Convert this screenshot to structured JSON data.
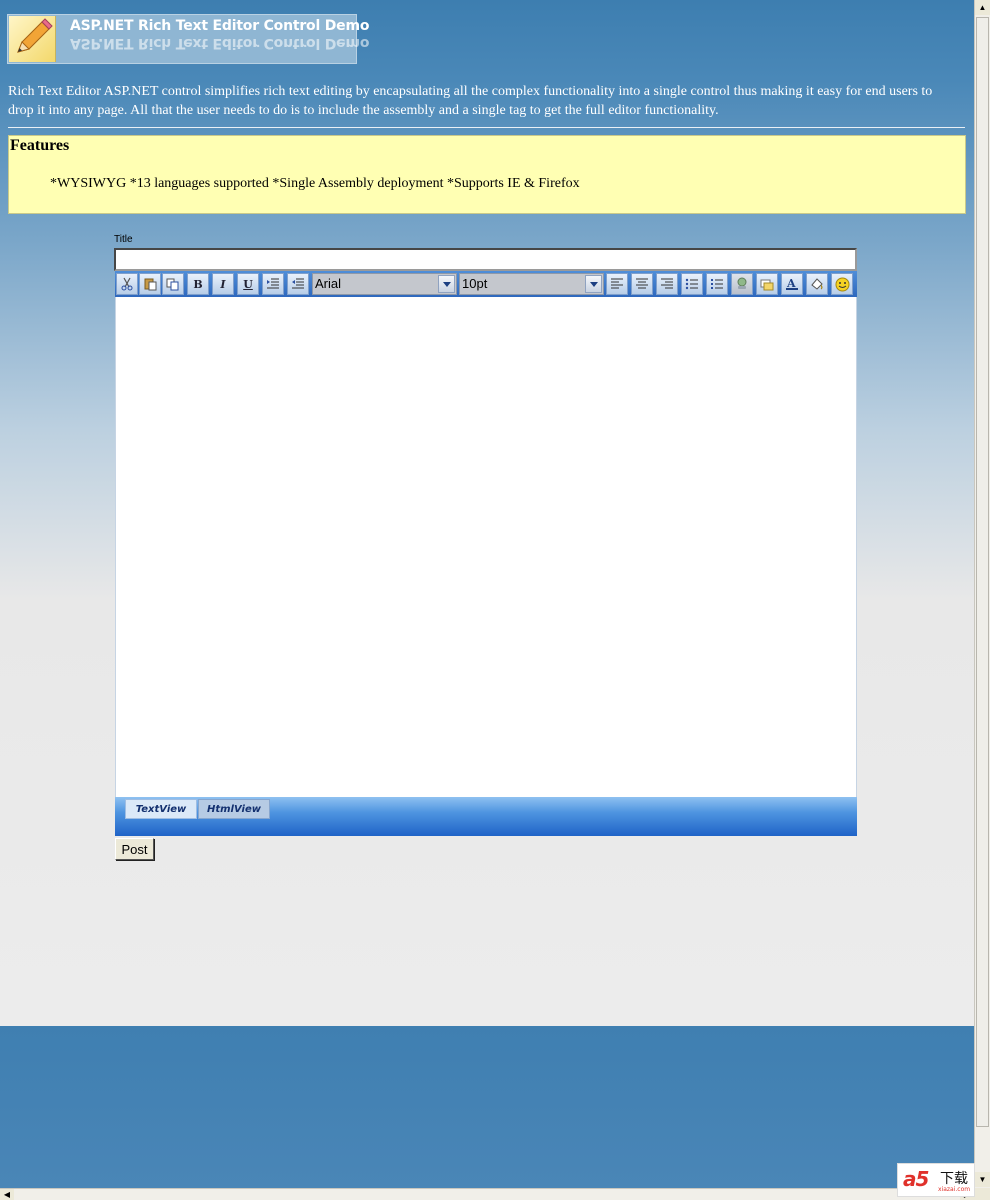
{
  "header": {
    "banner_title": "ASP.NET Rich Text Editor Control Demo",
    "banner_reflection": "ASP.NET Rich Text Editor Control Demo",
    "banner_icon": "pencil-icon"
  },
  "intro": {
    "text": "Rich Text Editor ASP.NET control simplifies rich text editing by encapsulating all the complex functionality into a single control thus making it easy for end users to drop it into any page. All that the user needs to do is to include the assembly and a single tag to get the full editor functionality."
  },
  "features": {
    "heading": "Features",
    "text": "*WYSIWYG *13 languages supported *Single Assembly deployment *Supports IE & Firefox"
  },
  "form": {
    "title_label": "Title",
    "title_value": "",
    "post_label": "Post"
  },
  "editor": {
    "toolbar": {
      "buttons_left": [
        "cut-icon",
        "paste-icon",
        "copy-icon",
        "bold-icon",
        "italic-icon",
        "underline-icon",
        "indent-icon",
        "outdent-icon"
      ],
      "bold_text": "B",
      "italic_text": "I",
      "underline_text": "U",
      "font_name": "Arial",
      "font_size": "10pt",
      "buttons_right": [
        "align-left-icon",
        "align-center-icon",
        "align-right-icon",
        "bullet-list-icon",
        "numbered-list-icon",
        "link-icon",
        "image-icon",
        "font-color-icon",
        "highlight-icon",
        "smiley-icon"
      ]
    },
    "content": "",
    "tabs": {
      "text_view": "TextView",
      "html_view": "HtmlView",
      "active": "TextView"
    }
  },
  "watermark": {
    "logo": "a5",
    "chinese": "下载",
    "domain": "xiazai.com"
  },
  "colors": {
    "page_gradient_top": "#3d7eb0",
    "page_bottom": "#ececec",
    "features_bg": "#ffffb3",
    "toolbar_blue": "#2e68bd"
  }
}
